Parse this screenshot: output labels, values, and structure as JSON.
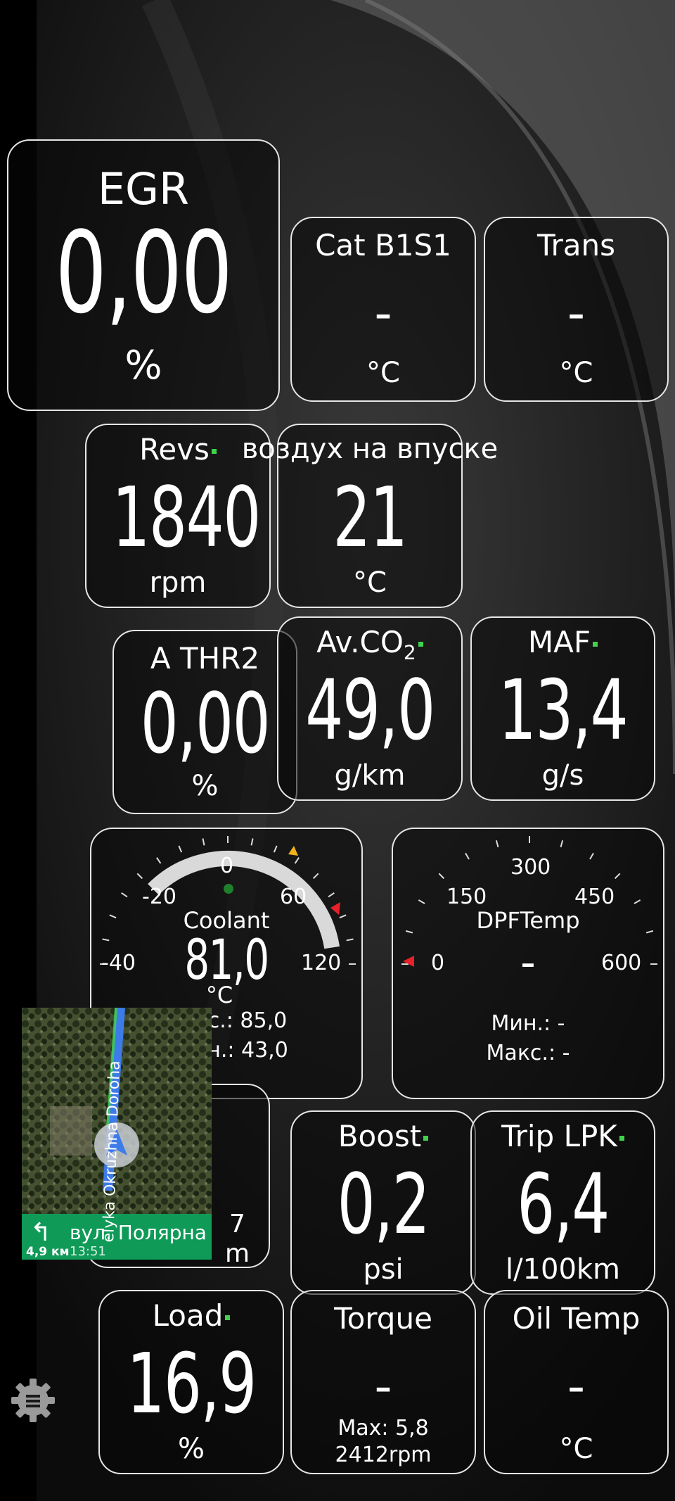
{
  "gauges": {
    "egr": {
      "label": "EGR",
      "value": "0,00",
      "unit": "%"
    },
    "cat": {
      "label": "Cat B1S1",
      "value": "-",
      "unit": "°C"
    },
    "trans": {
      "label": "Trans",
      "value": "-",
      "unit": "°C"
    },
    "revs": {
      "label": "Revs",
      "value": "1840",
      "unit": "rpm"
    },
    "intake": {
      "label": "воздух на впуске",
      "value": "21",
      "unit": "°C"
    },
    "athr": {
      "label": "A THR2",
      "value": "0,00",
      "unit": "%"
    },
    "co2": {
      "label": "Av.CO",
      "sub": "2",
      "value": "49,0",
      "unit": "g/km"
    },
    "maf": {
      "label": "MAF",
      "value": "13,4",
      "unit": "g/s"
    },
    "coolant": {
      "label": "Coolant",
      "value": "81,0",
      "unit": "°C",
      "max_text": "с.: 85,0",
      "min_text": "н.: 43,0",
      "ticks": [
        "-40",
        "-20",
        "0",
        "60",
        "120"
      ],
      "min": -40,
      "max": 120,
      "current": 81.0
    },
    "dpf": {
      "label": "DPFTemp",
      "value": "-",
      "min_text": "Мин.: -",
      "max_text": "Макс.: -",
      "ticks": [
        "0",
        "150",
        "300",
        "450",
        "600"
      ],
      "min": 0,
      "max": 600
    },
    "hidden": {
      "value_fragment": "7",
      "unit_fragment": "m"
    },
    "boost": {
      "label": "Boost",
      "value": "0,2",
      "unit": "psi"
    },
    "trip": {
      "label": "Trip LPK",
      "value": "6,4",
      "unit": "l/100km"
    },
    "load": {
      "label": "Load",
      "value": "16,9",
      "unit": "%"
    },
    "torque": {
      "label": "Torque",
      "value": "-",
      "max_line1": "Max: 5,8",
      "max_line2": "2412rpm"
    },
    "oil": {
      "label": "Oil Temp",
      "value": "-",
      "unit": "°C"
    }
  },
  "map": {
    "road": "elyka Okruzhna Doroha",
    "street": "вул. Полярна",
    "distance": "4,9 км",
    "time": "13:51"
  },
  "colors": {
    "accent_green": "#3fd24a",
    "map_bar": "#0f9a58",
    "route_blue": "#3d7be8",
    "warn_red": "#e8202a",
    "warn_amber": "#f2b21a"
  },
  "icons": {
    "settings": "gear-icon",
    "turn": "turn-left-icon",
    "nav": "navigation-arrow-icon"
  }
}
